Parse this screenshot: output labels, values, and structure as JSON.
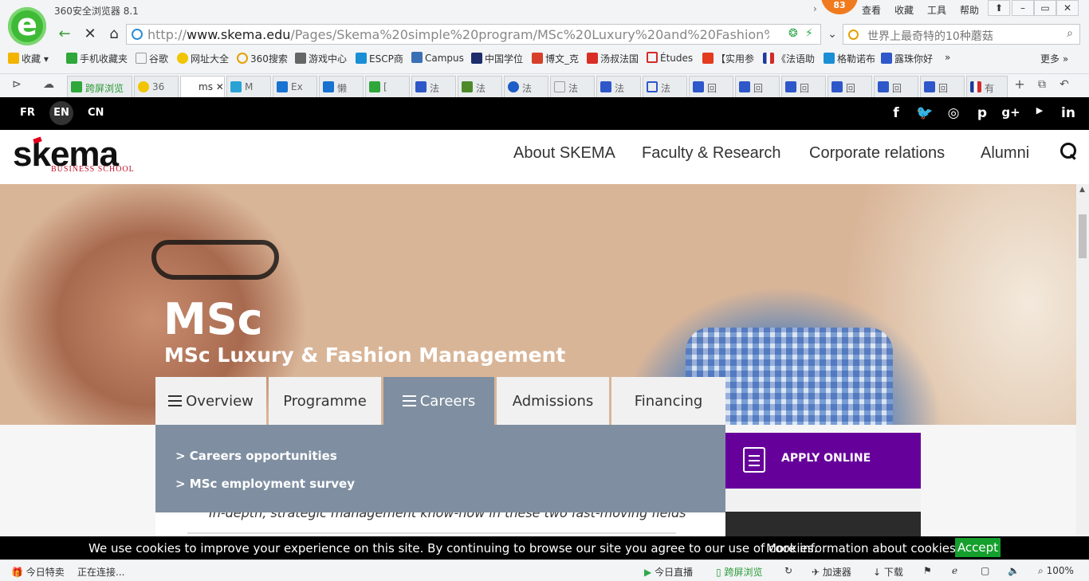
{
  "browser": {
    "app_title": "360安全浏览器 8.1",
    "badge": "83",
    "menu": [
      "查看",
      "收藏",
      "工具",
      "帮助"
    ],
    "address": "http://www.skema.edu/Pages/Skema%20simple%20program/MSc%20Luxury%20and%20Fashion%20Managen",
    "address_host": "www.skema.edu",
    "address_prefix": "http://",
    "address_path": "/Pages/Skema%20simple%20program/MSc%20Luxury%20and%20Fashion%20Managen",
    "search_placeholder": "世界上最奇特的10种蘑菇",
    "bookmarks": [
      "收藏",
      "手机收藏夹",
      "谷歌",
      "网址大全",
      "360搜索",
      "游戏中心",
      "ESCP商",
      "Campus",
      "中国学位",
      "博文_克",
      "汤叔法国",
      "Études",
      "【实用参",
      "《法语助",
      "格勒诺布",
      "露珠你好"
    ],
    "more": "更多",
    "tabs": [
      "跨屏浏览",
      "36",
      "ms",
      "M",
      "Ex",
      "懒",
      "[",
      "法",
      "法",
      "法",
      "法",
      "法",
      "法",
      "回",
      "回",
      "回",
      "回",
      "回",
      "回",
      "有"
    ],
    "status": {
      "left1": "今日特卖",
      "left2": "正在连接...",
      "live": "今日直播",
      "cross": "跨屏浏览",
      "accelerate": "加速器",
      "download": "下载",
      "zoom": "100%"
    }
  },
  "site": {
    "langs": [
      "FR",
      "EN",
      "CN"
    ],
    "social": [
      "f",
      "t",
      "ig",
      "p",
      "g+",
      "yt",
      "in"
    ],
    "logo": {
      "word": "skema",
      "sub": "BUSINESS SCHOOL"
    },
    "nav": [
      "About SKEMA",
      "Faculty & Research",
      "Corporate relations",
      "Alumni"
    ],
    "hero": {
      "title": "MSc",
      "subtitle": "MSc Luxury & Fashion Management"
    },
    "tabs": [
      "Overview",
      "Programme",
      "Careers",
      "Admissions",
      "Financing"
    ],
    "dropdown": [
      "> Careers opportunities",
      "> MSc employment survey"
    ],
    "intro": "In-depth, strategic management know-how in these two fast-moving fields",
    "apply": "APPLY ONLINE",
    "cookie": {
      "text": "We use cookies to improve your experience on this site. By continuing to browse our site you agree to our use of cookies.",
      "more": "More information about cookies",
      "accept": "Accept"
    }
  }
}
